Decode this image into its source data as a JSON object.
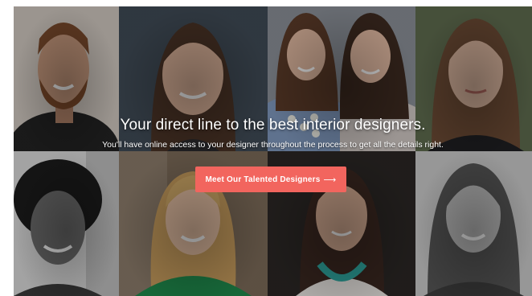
{
  "hero": {
    "headline": "Your direct line to the best interior designers.",
    "subline": "You'll have online access to your designer throughout the process to get all the details right.",
    "cta_label": "Meet Our Talented Designers",
    "cta_arrow": "⟶",
    "cta_color": "#f2655e"
  },
  "photos": [
    {
      "name": "designer-photo-bearded-man"
    },
    {
      "name": "designer-photo-brunette-woman"
    },
    {
      "name": "designer-photo-two-women"
    },
    {
      "name": "designer-photo-woman-dark-top"
    },
    {
      "name": "designer-photo-curly-hair-woman"
    },
    {
      "name": "designer-photo-blonde-woman-green"
    },
    {
      "name": "designer-photo-woman-necklace"
    },
    {
      "name": "designer-photo-woman-bw"
    }
  ]
}
